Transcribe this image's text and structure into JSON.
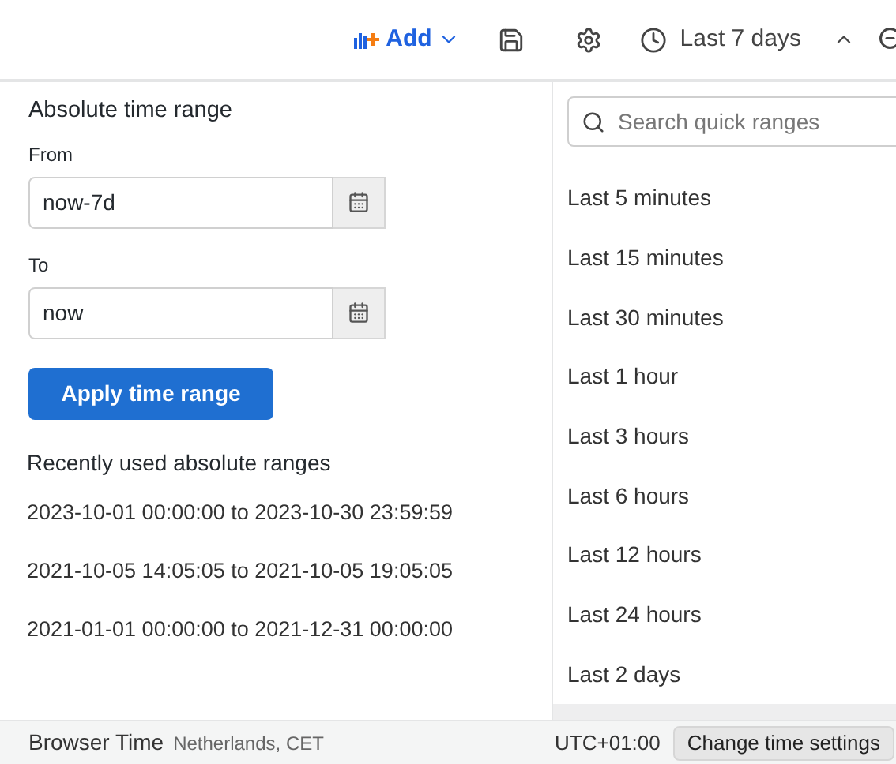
{
  "toolbar": {
    "add_label": "Add",
    "time_range_label": "Last 7 days"
  },
  "absolute": {
    "title": "Absolute time range",
    "fields": [
      {
        "label": "From",
        "value": "now-7d"
      },
      {
        "label": "To",
        "value": "now"
      }
    ],
    "apply_button": "Apply time range",
    "recent_title": "Recently used absolute ranges",
    "recent": [
      "2023-10-01 00:00:00 to 2023-10-30 23:59:59",
      "2021-10-05 14:05:05 to 2021-10-05 19:05:05",
      "2021-01-01 00:00:00 to 2021-12-31 00:00:00"
    ]
  },
  "quick": {
    "search_placeholder": "Search quick ranges",
    "items": [
      "Last 5 minutes",
      "Last 15 minutes",
      "Last 30 minutes",
      "Last 1 hour",
      "Last 3 hours",
      "Last 6 hours",
      "Last 12 hours",
      "Last 24 hours",
      "Last 2 days"
    ]
  },
  "footer": {
    "title": "Browser Time",
    "zone": "Netherlands, CET",
    "offset": "UTC+01:00",
    "button": "Change time settings"
  }
}
